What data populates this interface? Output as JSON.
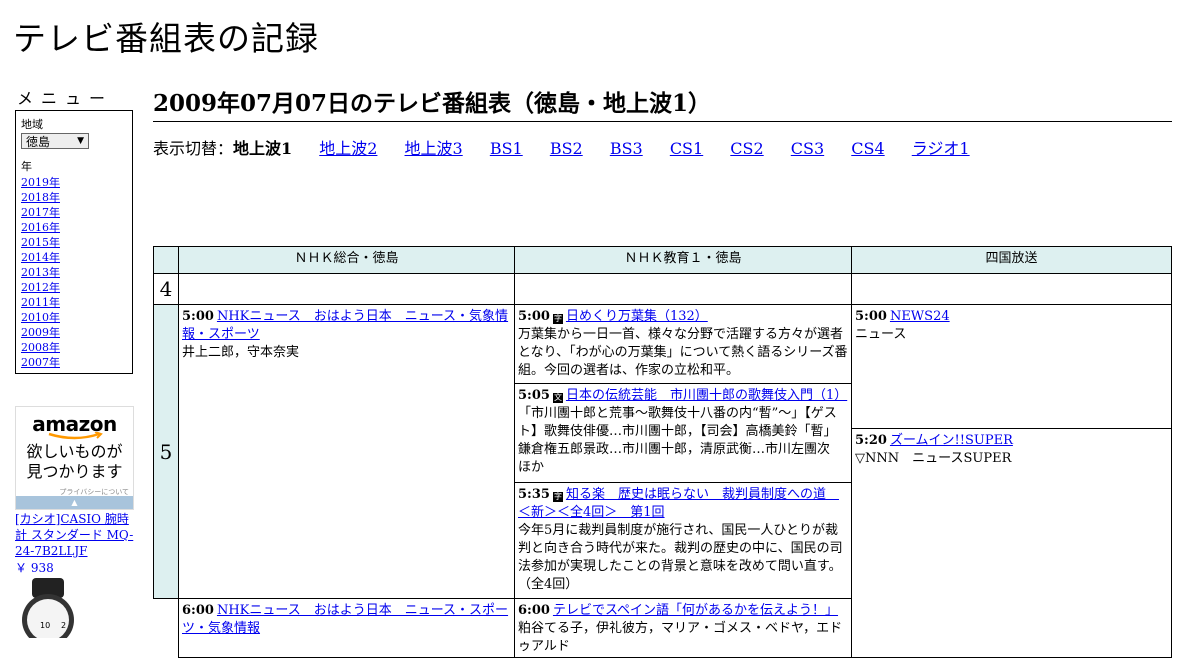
{
  "site": {
    "title": "テレビ番組表の記録"
  },
  "sidebar": {
    "menu_heading": "メニュー",
    "region_label": "地域",
    "region_value": "徳島",
    "year_label": "年",
    "years": [
      "2019年",
      "2018年",
      "2017年",
      "2016年",
      "2015年",
      "2014年",
      "2013年",
      "2012年",
      "2011年",
      "2010年",
      "2009年",
      "2008年",
      "2007年"
    ],
    "ad": {
      "logo": "amazon",
      "copy_line1": "欲しいものが",
      "copy_line2": "見つかります",
      "privacy": "プライバシーについて"
    },
    "product": {
      "name": "[カシオ]CASIO 腕時計 スタンダード MQ-24-7B2LLJF",
      "price": "￥ 938"
    }
  },
  "main": {
    "heading": "2009年07月07日のテレビ番組表（徳島・地上波1）",
    "switch_label": "表示切替：",
    "switch_current": "地上波1",
    "switch_links": [
      "地上波2",
      "地上波3",
      "BS1",
      "BS2",
      "BS3",
      "CS1",
      "CS2",
      "CS3",
      "CS4",
      "ラジオ1"
    ]
  },
  "schedule": {
    "channels": [
      "ＮＨＫ総合・徳島",
      "ＮＨＫ教育１・徳島",
      "四国放送"
    ],
    "hours": [
      "4",
      "5"
    ],
    "programs": {
      "nhk_g_500": {
        "time": "5:00",
        "title": "NHKニュース　おはよう日本　ニュース・気象情報・スポーツ",
        "desc": "井上二郎，守本奈実"
      },
      "nhk_g_600": {
        "time": "6:00",
        "title": "NHKニュース　おはよう日本　ニュース・スポーツ・気象情報"
      },
      "nhk_e_500": {
        "time": "5:00",
        "icon": "字",
        "title": "日めくり万葉集（132）",
        "desc": "万葉集から一日一首、様々な分野で活躍する方々が選者となり、「わが心の万葉集」について熱く語るシリーズ番組。今回の選者は、作家の立松和平。"
      },
      "nhk_e_505": {
        "time": "5:05",
        "icon": "文",
        "title": "日本の伝統芸能　市川團十郎の歌舞伎入門（1）",
        "desc": "「市川團十郎と荒事～歌舞伎十八番の内“暫”～」【ゲスト】歌舞伎俳優…市川團十郎，【司会】高橋美鈴「暫」鎌倉権五郎景政…市川團十郎，清原武衡…市川左團次　ほか"
      },
      "nhk_e_535": {
        "time": "5:35",
        "icon": "字",
        "title": "知る楽　歴史は眠らない　裁判員制度への道　＜新＞＜全4回＞　第1回",
        "desc": "今年5月に裁判員制度が施行され、国民一人ひとりが裁判と向き合う時代が来た。裁判の歴史の中に、国民の司法参加が実現したことの背景と意味を改めて問い直す。（全4回）"
      },
      "nhk_e_600": {
        "time": "6:00",
        "title": "テレビでスペイン語「何があるかを伝えよう！」",
        "desc": "粕谷てる子，伊礼彼方，マリア・ゴメス・ベドヤ，エドゥアルド"
      },
      "jrt_500": {
        "time": "5:00",
        "title": "NEWS24",
        "desc": "ニュース"
      },
      "jrt_520": {
        "time": "5:20",
        "title": "ズームイン!!SUPER",
        "desc": "▽NNN　ニュースSUPER"
      }
    }
  },
  "colors": {
    "header_bg": "#ddf0f0",
    "link": "#0000ee"
  }
}
